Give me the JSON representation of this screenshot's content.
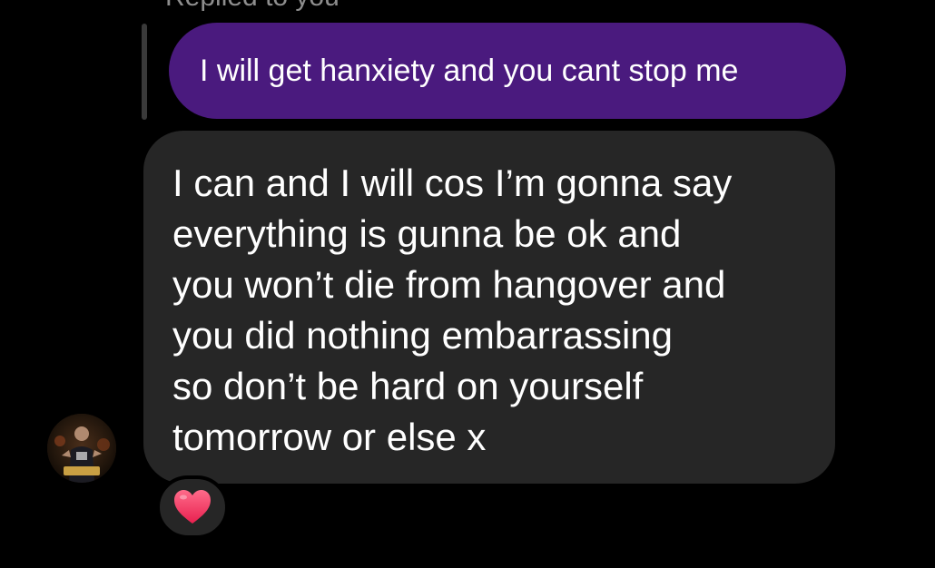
{
  "thread": {
    "replied_label": "Replied to you",
    "quoted_message": "I will get hanxiety and you cant stop me",
    "message_lines": [
      "I can and I will cos I’m gonna say",
      "everything is gunna be ok and",
      "you won’t die from hangover and",
      "you did nothing embarrassing",
      "so don’t be hard on yourself",
      "tomorrow or else x"
    ],
    "reaction": {
      "icon": "heart-icon",
      "color": "#f0446b"
    }
  },
  "colors": {
    "background": "#000000",
    "quoted_bubble": "#4a1a7e",
    "message_bubble": "#262626",
    "reply_bar": "#3a3a3a",
    "text": "#ffffff"
  }
}
